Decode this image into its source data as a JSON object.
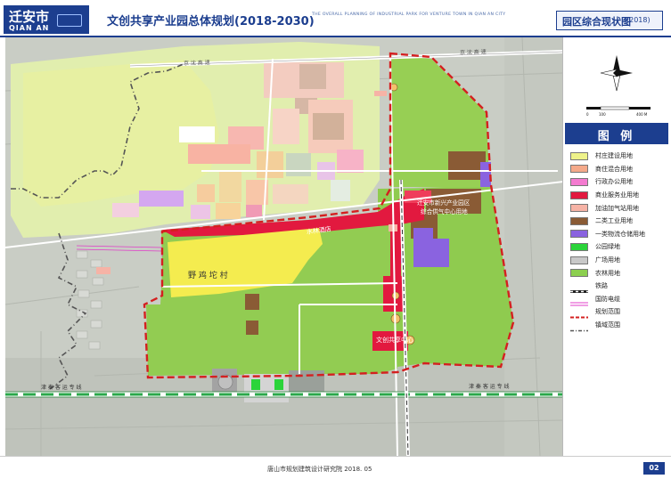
{
  "header": {
    "city_name": "迁安市",
    "city_name_en": "QIAN AN",
    "emblem_text": "",
    "plan_title": "文创共享产业园总体规划(2018-2030)",
    "plan_title_en": "THE OVERALL PLANNING OF INDUSTRIAL PARK FOR VENTURE TOWN IN QIAN AN CITY",
    "sheet_title": "园区综合现状图",
    "sheet_year": "(2018)"
  },
  "map": {
    "labels": {
      "village": "野 鸡 坨 村",
      "shuilin": "水林酒店",
      "center": "文创共享中心",
      "station_note_line1": "迁安市新兴产业园区",
      "station_note_line2": "综合供气中心用地",
      "road_top": "京 沈 高 速",
      "road_top_right": "京 沈 高 速",
      "rail_left": "津 秦 客 运 专 线",
      "rail_right": "津 秦 客 运 专 线"
    }
  },
  "compass": {
    "north_label": "N"
  },
  "scale": {
    "labels": [
      "0",
      "100",
      "400 M"
    ]
  },
  "legend": {
    "title": "图 例",
    "items": [
      {
        "label": "村庄建设用地",
        "color": "#eef28a",
        "kind": "fill"
      },
      {
        "label": "商住混合用地",
        "color": "#f4a98a",
        "kind": "fill"
      },
      {
        "label": "行政办公用地",
        "color": "#f47bd0",
        "kind": "fill"
      },
      {
        "label": "商业服务业用地",
        "color": "#e2193f",
        "kind": "fill"
      },
      {
        "label": "加油加气站用地",
        "color": "#f6b3a6",
        "kind": "fill"
      },
      {
        "label": "二类工业用地",
        "color": "#8a5b35",
        "kind": "fill"
      },
      {
        "label": "一类物流仓储用地",
        "color": "#8a63e0",
        "kind": "fill"
      },
      {
        "label": "公园绿地",
        "color": "#2bd43a",
        "kind": "fill"
      },
      {
        "label": "广场用地",
        "color": "#c8c8c8",
        "kind": "fill"
      },
      {
        "label": "农林用地",
        "color": "#8ccf4f",
        "kind": "fill"
      },
      {
        "label": "铁路",
        "color": "#222222",
        "kind": "rail"
      },
      {
        "label": "国防电缆",
        "color": "#e03cc8",
        "kind": "double"
      },
      {
        "label": "规划范围",
        "color": "#d42020",
        "kind": "dash"
      },
      {
        "label": "镇域范围",
        "color": "#555555",
        "kind": "dotdash"
      }
    ]
  },
  "footer": {
    "credit": "唐山市规划建筑设计研究院  2018. 05",
    "page": "02"
  }
}
